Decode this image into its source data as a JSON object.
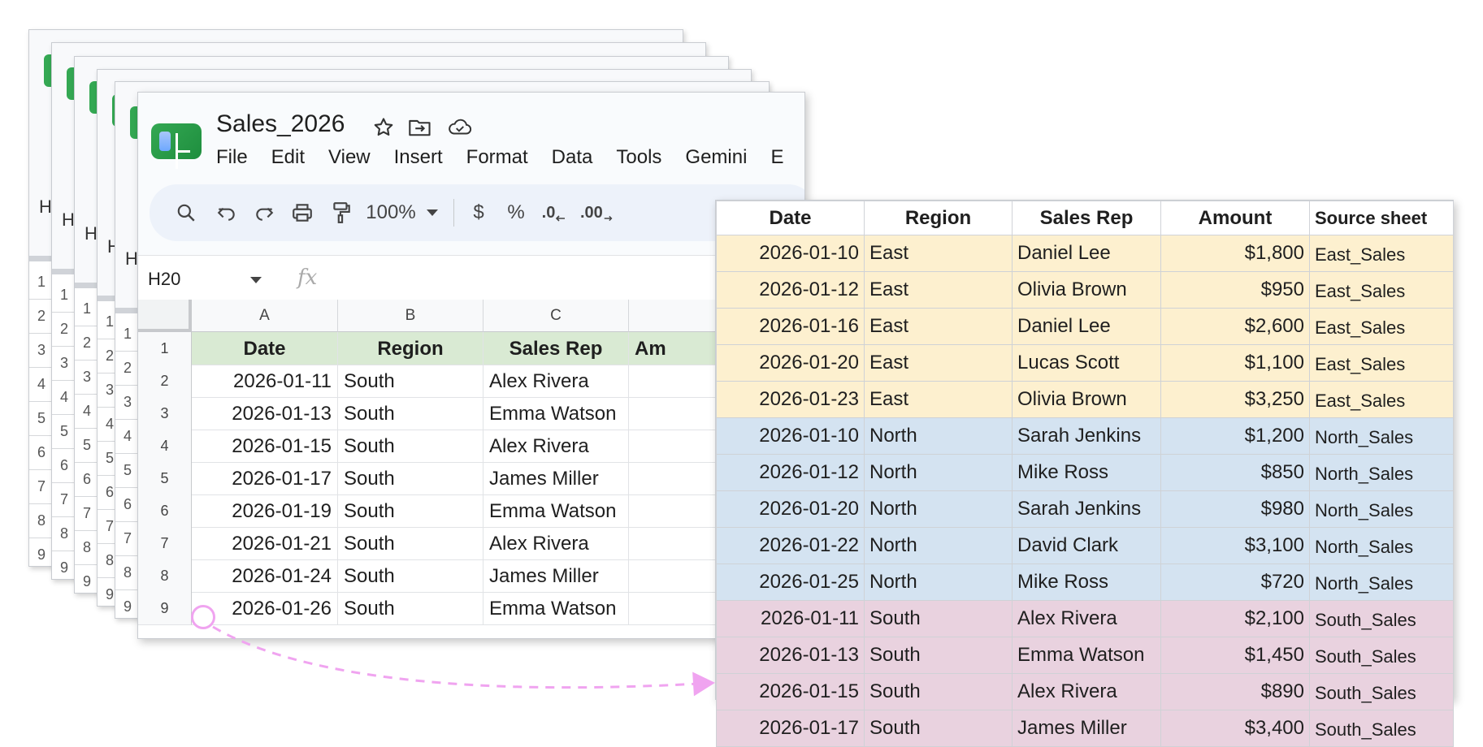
{
  "background_sheets": {
    "header_letter": "H",
    "row_numbers": [
      "1",
      "2",
      "3",
      "4",
      "5",
      "6",
      "7",
      "8",
      "9"
    ]
  },
  "spreadsheet": {
    "title": "Sales_2026",
    "menu": [
      "File",
      "Edit",
      "View",
      "Insert",
      "Format",
      "Data",
      "Tools",
      "Gemini",
      "E"
    ],
    "toolbar": {
      "zoom": "100%",
      "currency": "$",
      "percent": "%",
      "decrease_decimals": ".0",
      "increase_decimals": ".00"
    },
    "name_box": "H20",
    "fx_label": "fx",
    "columns": [
      "A",
      "B",
      "C"
    ],
    "header_row": [
      "Date",
      "Region",
      "Sales Rep",
      "Am"
    ],
    "row_numbers": [
      "1",
      "2",
      "3",
      "4",
      "5",
      "6",
      "7",
      "8",
      "9"
    ],
    "rows": [
      {
        "date": "2026-01-11",
        "region": "South",
        "rep": "Alex Rivera"
      },
      {
        "date": "2026-01-13",
        "region": "South",
        "rep": "Emma Watson"
      },
      {
        "date": "2026-01-15",
        "region": "South",
        "rep": "Alex Rivera"
      },
      {
        "date": "2026-01-17",
        "region": "South",
        "rep": "James Miller"
      },
      {
        "date": "2026-01-19",
        "region": "South",
        "rep": "Emma Watson"
      },
      {
        "date": "2026-01-21",
        "region": "South",
        "rep": "Alex Rivera"
      },
      {
        "date": "2026-01-24",
        "region": "South",
        "rep": "James Miller"
      },
      {
        "date": "2026-01-26",
        "region": "South",
        "rep": "Emma Watson"
      }
    ]
  },
  "combined_table": {
    "headers": [
      "Date",
      "Region",
      "Sales Rep",
      "Amount",
      "Source sheet"
    ],
    "group_colors": {
      "east": "#fdf0cf",
      "north": "#d4e3f1",
      "south": "#e9d2df"
    },
    "rows": [
      {
        "group": "east",
        "date": "2026-01-10",
        "region": "East",
        "rep": "Daniel Lee",
        "amount": "$1,800",
        "source": "East_Sales"
      },
      {
        "group": "east",
        "date": "2026-01-12",
        "region": "East",
        "rep": "Olivia Brown",
        "amount": "$950",
        "source": "East_Sales"
      },
      {
        "group": "east",
        "date": "2026-01-16",
        "region": "East",
        "rep": "Daniel Lee",
        "amount": "$2,600",
        "source": "East_Sales"
      },
      {
        "group": "east",
        "date": "2026-01-20",
        "region": "East",
        "rep": "Lucas Scott",
        "amount": "$1,100",
        "source": "East_Sales"
      },
      {
        "group": "east",
        "date": "2026-01-23",
        "region": "East",
        "rep": "Olivia Brown",
        "amount": "$3,250",
        "source": "East_Sales"
      },
      {
        "group": "north",
        "date": "2026-01-10",
        "region": "North",
        "rep": "Sarah Jenkins",
        "amount": "$1,200",
        "source": "North_Sales"
      },
      {
        "group": "north",
        "date": "2026-01-12",
        "region": "North",
        "rep": "Mike Ross",
        "amount": "$850",
        "source": "North_Sales"
      },
      {
        "group": "north",
        "date": "2026-01-20",
        "region": "North",
        "rep": "Sarah Jenkins",
        "amount": "$980",
        "source": "North_Sales"
      },
      {
        "group": "north",
        "date": "2026-01-22",
        "region": "North",
        "rep": "David Clark",
        "amount": "$3,100",
        "source": "North_Sales"
      },
      {
        "group": "north",
        "date": "2026-01-25",
        "region": "North",
        "rep": "Mike Ross",
        "amount": "$720",
        "source": "North_Sales"
      },
      {
        "group": "south",
        "date": "2026-01-11",
        "region": "South",
        "rep": "Alex Rivera",
        "amount": "$2,100",
        "source": "South_Sales"
      },
      {
        "group": "south",
        "date": "2026-01-13",
        "region": "South",
        "rep": "Emma Watson",
        "amount": "$1,450",
        "source": "South_Sales"
      },
      {
        "group": "south",
        "date": "2026-01-15",
        "region": "South",
        "rep": "Alex Rivera",
        "amount": "$890",
        "source": "South_Sales"
      },
      {
        "group": "south",
        "date": "2026-01-17",
        "region": "South",
        "rep": "James Miller",
        "amount": "$3,400",
        "source": "South_Sales"
      }
    ]
  }
}
